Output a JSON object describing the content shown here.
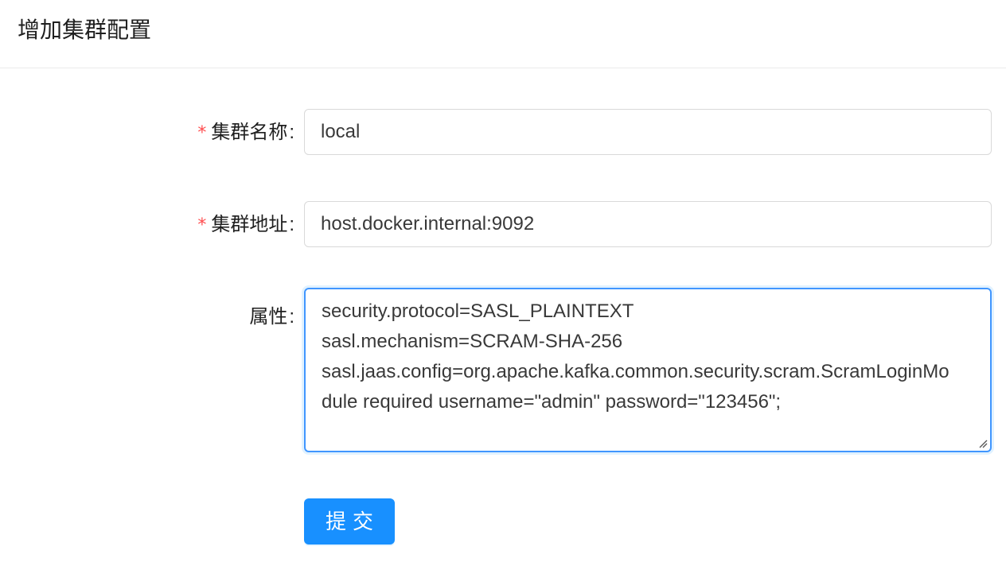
{
  "page": {
    "title": "增加集群配置"
  },
  "form": {
    "cluster_name": {
      "required_mark": "*",
      "label": "集群名称",
      "colon": ":",
      "value": "local"
    },
    "cluster_address": {
      "required_mark": "*",
      "label": "集群地址",
      "colon": ":",
      "value": "host.docker.internal:9092"
    },
    "properties": {
      "label": "属性",
      "colon": ":",
      "lines": [
        "security.protocol=SASL_PLAINTEXT",
        "sasl.mechanism=SCRAM-SHA-256",
        "sasl.jaas.config=org.apache.kafka.common.security.scram.ScramLoginMo",
        "dule required username=\"admin\" password=\"123456\";"
      ]
    },
    "submit_label": "提交"
  },
  "colors": {
    "primary": "#1890ff",
    "required": "#ff4d4f",
    "focus_border": "#4096ff",
    "input_border": "#d9d9d9"
  }
}
